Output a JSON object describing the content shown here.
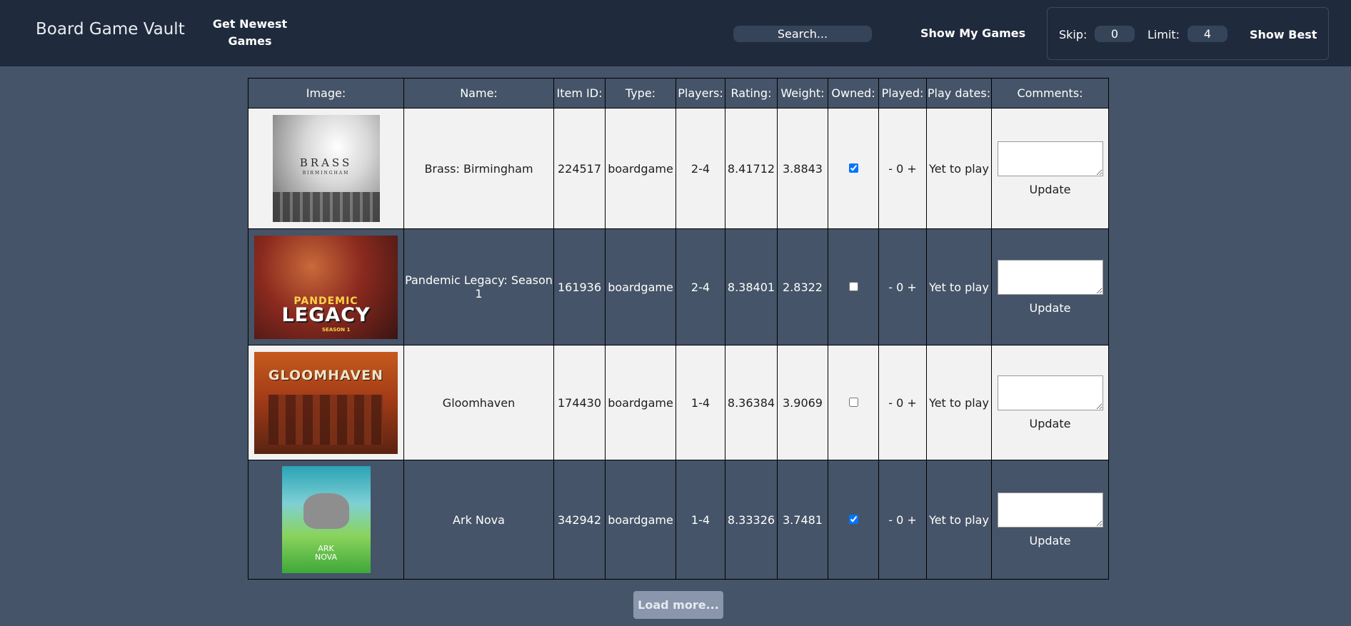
{
  "header": {
    "brand": "Board Game Vault",
    "newest_label": "Get Newest Games",
    "search_placeholder": "Search...",
    "my_games_label": "Show My Games",
    "skip_label": "Skip:",
    "skip_value": "0",
    "limit_label": "Limit:",
    "limit_value": "4",
    "show_best_label": "Show Best"
  },
  "table": {
    "headers": [
      "Image:",
      "Name:",
      "Item ID:",
      "Type:",
      "Players:",
      "Rating:",
      "Weight:",
      "Owned:",
      "Played:",
      "Play dates:",
      "Comments:"
    ],
    "rows": [
      {
        "image_art": {
          "title": "BRASS",
          "subtitle": "BIRMINGHAM"
        },
        "name": "Brass: Birmingham",
        "item_id": "224517",
        "type": "boardgame",
        "players": "2-4",
        "rating": "8.41712",
        "weight": "3.8843",
        "owned": true,
        "played_minus": "-",
        "played_count": "0",
        "played_plus": "+",
        "play_dates": "Yet to play",
        "comment": "",
        "update_label": "Update"
      },
      {
        "image_art": {
          "title": "PANDEMIC",
          "subtitle": "LEGACY",
          "tag": "SEASON 1"
        },
        "name": "Pandemic Legacy: Season 1",
        "item_id": "161936",
        "type": "boardgame",
        "players": "2-4",
        "rating": "8.38401",
        "weight": "2.8322",
        "owned": false,
        "played_minus": "-",
        "played_count": "0",
        "played_plus": "+",
        "play_dates": "Yet to play",
        "comment": "",
        "update_label": "Update"
      },
      {
        "image_art": {
          "title": "GLOOMHAVEN"
        },
        "name": "Gloomhaven",
        "item_id": "174430",
        "type": "boardgame",
        "players": "1-4",
        "rating": "8.36384",
        "weight": "3.9069",
        "owned": false,
        "played_minus": "-",
        "played_count": "0",
        "played_plus": "+",
        "play_dates": "Yet to play",
        "comment": "",
        "update_label": "Update"
      },
      {
        "image_art": {
          "title": "ARK",
          "subtitle": "NOVA"
        },
        "name": "Ark Nova",
        "item_id": "342942",
        "type": "boardgame",
        "players": "1-4",
        "rating": "8.33326",
        "weight": "3.7481",
        "owned": true,
        "played_minus": "-",
        "played_count": "0",
        "played_plus": "+",
        "play_dates": "Yet to play",
        "comment": "",
        "update_label": "Update"
      }
    ]
  },
  "footer": {
    "load_more_label": "Load more..."
  },
  "colors": {
    "page_bg": "#455468",
    "topbar_bg": "#1f2a3c",
    "light_row": "#f2f2f2",
    "load_more_bg": "#8996ac"
  }
}
